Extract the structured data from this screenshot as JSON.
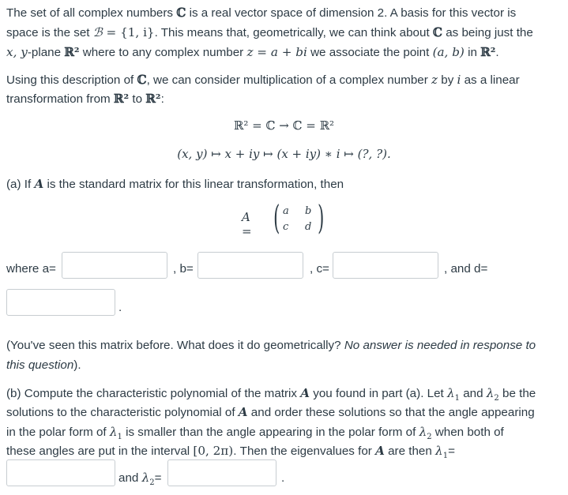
{
  "intro": {
    "line1": {
      "pre": "The set of all complex numbers ",
      "C": "ℂ",
      "post": " is a real vector space of dimension 2. A basis for this vector is"
    },
    "line2": {
      "pre": "space is the set ",
      "B": "ℬ",
      "set": " = {1, i}",
      "mid": ". This means that, geometrically, we can think about ",
      "C": "ℂ",
      "post": " as being just the"
    },
    "line3": {
      "xy": "x, y",
      "pre": "-plane ",
      "R2": "ℝ²",
      "mid": " where to any complex number ",
      "z": "z = a + bi",
      "mid2": " we associate the point ",
      "point": "(a, b)",
      "in": " in ",
      "R2b": "ℝ²",
      "end": "."
    }
  },
  "para2": {
    "line1": {
      "pre": "Using this description of ",
      "C": "ℂ",
      "mid": ", we can consider multiplication of a complex number ",
      "z": "z",
      "by": " by ",
      "i": "i",
      "post": " as a linear"
    },
    "line2": {
      "pre": "transformation from ",
      "R2": "ℝ²",
      "to": " to ",
      "R2b": "ℝ²",
      "post": ":"
    }
  },
  "display": {
    "eq1": "ℝ² = ℂ → ℂ = ℝ²",
    "eq2": "(x, y) ↦ x + iy ↦ (x + iy) ∗ i ↦ (?, ?)."
  },
  "part_a": {
    "pre": "(a) If ",
    "A": "A",
    "post": " is the standard matrix for this linear transformation, then",
    "matrix_lhs": "A =",
    "matrix_cells": [
      "a",
      "b",
      "c",
      "d"
    ],
    "label_a": "where a=",
    "label_b": ", b=",
    "label_c": ", c=",
    "label_d": ", and d=",
    "end": ".",
    "inputs": {
      "a": "",
      "b": "",
      "c": "",
      "d": ""
    }
  },
  "note": {
    "normal": "(You've seen this matrix before. What does it do geometrically? ",
    "italic1": "No answer is needed in response to",
    "italic2": "this question",
    "end": ")."
  },
  "part_b": {
    "line1": {
      "pre": "(b) Compute the characteristic polynomial of the matrix ",
      "A": "A",
      "mid": " you found in part (a). Let ",
      "l1": "λ",
      "s1": "1",
      "and": " and ",
      "l2": "λ",
      "s2": "2",
      "post": " be the"
    },
    "line2": {
      "pre": "solutions to the characteristic polynomial of ",
      "A": "A",
      "post": " and order these solutions so that the angle appearing"
    },
    "line3": {
      "pre": "in the polar form of ",
      "l1": "λ",
      "s1": "1",
      "mid": " is smaller than the angle appearing in the polar form of ",
      "l2": "λ",
      "s2": "2",
      "post": " when both of"
    },
    "line4": {
      "pre": "these angles are put in the interval ",
      "interval": "[0, 2π)",
      "mid": ". Then the eigenvalues for ",
      "A": "A",
      "post": " are then ",
      "l1": "λ",
      "s1": "1",
      "eq": "="
    },
    "and_label": "and ",
    "l2": "λ",
    "s2": "2",
    "eq": "=",
    "end": ".",
    "inputs": {
      "lambda1": "",
      "lambda2": ""
    }
  }
}
